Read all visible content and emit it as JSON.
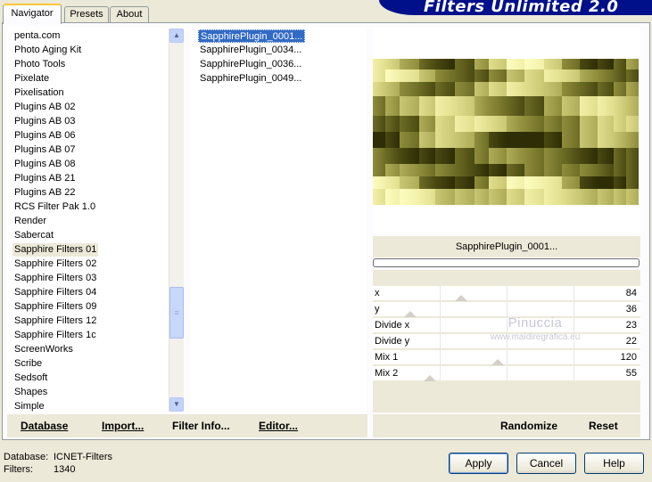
{
  "tabs": [
    {
      "label": "Navigator",
      "active": true
    },
    {
      "label": "Presets",
      "active": false
    },
    {
      "label": "About",
      "active": false
    }
  ],
  "banner": {
    "title": "Filters Unlimited 2.0"
  },
  "categories": {
    "items": [
      "penta.com",
      "Photo Aging Kit",
      "Photo Tools",
      "Pixelate",
      "Pixelisation",
      "Plugins AB 02",
      "Plugins AB 03",
      "Plugins AB 06",
      "Plugins AB 07",
      "Plugins AB 08",
      "Plugins AB 21",
      "Plugins AB 22",
      "RCS Filter Pak 1.0",
      "Render",
      "Sabercat",
      "Sapphire Filters 01",
      "Sapphire Filters 02",
      "Sapphire Filters 03",
      "Sapphire Filters 04",
      "Sapphire Filters 09",
      "Sapphire Filters 12",
      "Sapphire Filters 1c",
      "ScreenWorks",
      "Scribe",
      "Sedsoft",
      "Shapes",
      "Simple"
    ],
    "selected": "Sapphire Filters 01"
  },
  "filters": {
    "items": [
      "SapphirePlugin_0001...",
      "SapphirePlugin_0034...",
      "SapphirePlugin_0036...",
      "SapphirePlugin_0049..."
    ],
    "selected": "SapphirePlugin_0001..."
  },
  "preview": {
    "filter_name": "SapphirePlugin_0001..."
  },
  "params": [
    {
      "name": "x",
      "value": "84"
    },
    {
      "name": "y",
      "value": "36"
    },
    {
      "name": "Divide x",
      "value": "23"
    },
    {
      "name": "Divide y",
      "value": "22"
    },
    {
      "name": "Mix 1",
      "value": "120"
    },
    {
      "name": "Mix 2",
      "value": "55"
    }
  ],
  "watermark": {
    "line1": "Pinuccia",
    "line2": "www.maidiregrafica.eu"
  },
  "toolbar": {
    "database": "Database",
    "import": "Import...",
    "filter_info": "Filter Info...",
    "editor": "Editor...",
    "randomize": "Randomize",
    "reset": "Reset"
  },
  "status": {
    "database_label": "Database:",
    "database_value": "ICNET-Filters",
    "filters_label": "Filters:",
    "filters_value": "1340"
  },
  "buttons": {
    "apply": "Apply",
    "cancel": "Cancel",
    "help": "Help"
  },
  "colors": {
    "selection": "#316ac5",
    "banner": "#00108a",
    "preview_base": "#b6b46e"
  }
}
